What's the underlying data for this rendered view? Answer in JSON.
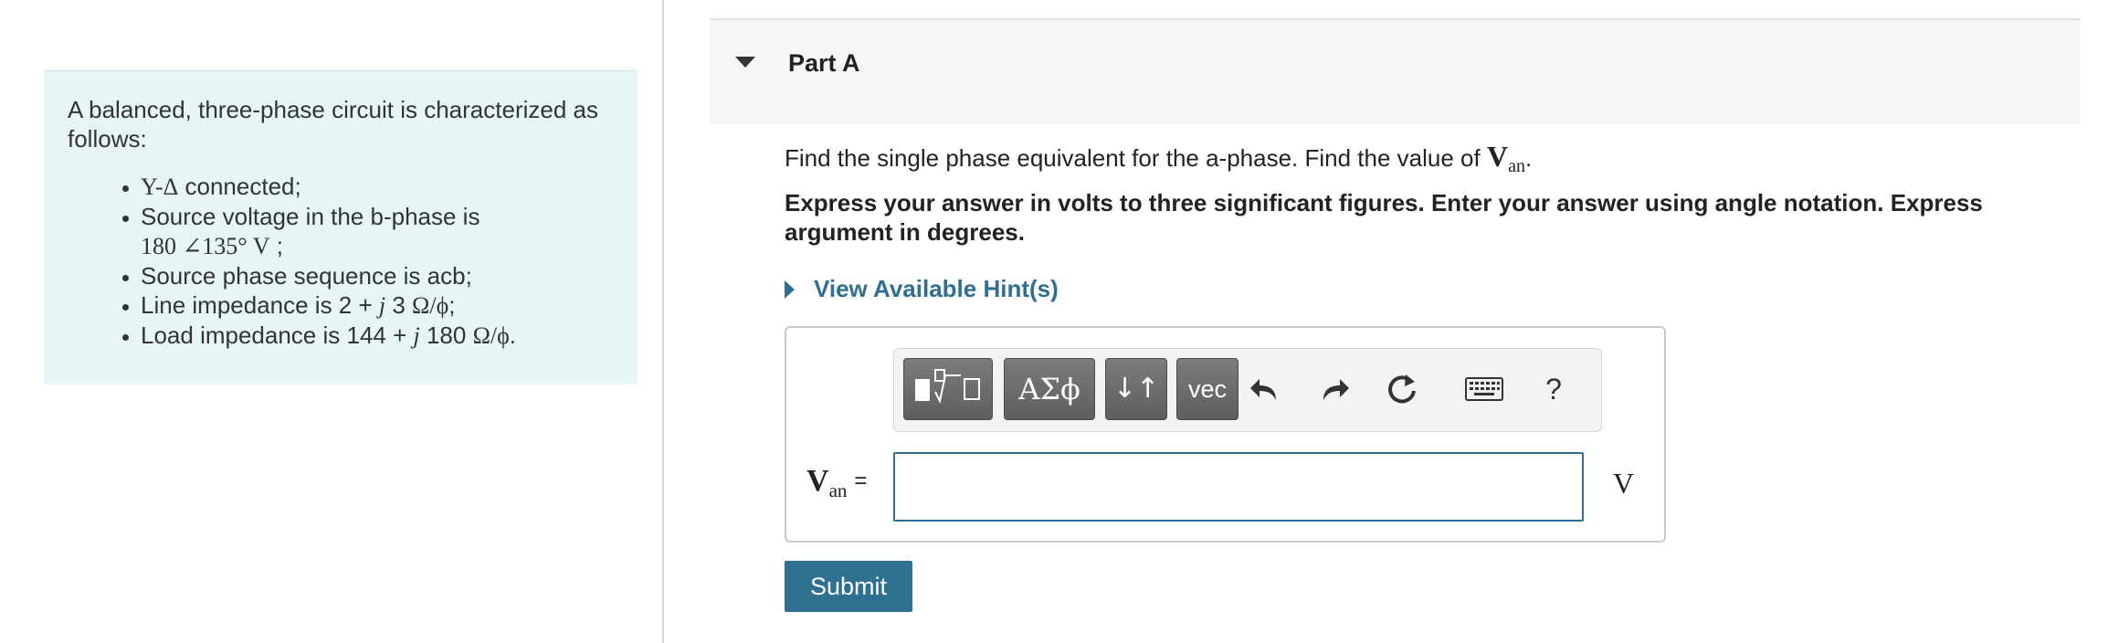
{
  "problem": {
    "intro": "A balanced, three-phase circuit is characterized as follows:",
    "conditions": [
      {
        "math": "Y-Δ",
        "text": " connected;"
      },
      {
        "text": "Source voltage in the b-phase is",
        "math": "180 ∠135°  V",
        "suffix": " ;"
      },
      {
        "text": "Source phase sequence is acb;"
      },
      {
        "text": "Line impedance is 2 + ",
        "j": "j",
        "num": " 3 ",
        "unit": "Ω/ϕ",
        "suffix": ";"
      },
      {
        "text": "Load impedance is 144 + ",
        "j": "j",
        "num": " 180 ",
        "unit": "Ω/ϕ",
        "suffix": "."
      }
    ]
  },
  "part": {
    "title": "Part A",
    "question_text": "Find the single phase equivalent for the a-phase. Find the value of ",
    "question_var": "V",
    "question_sub": "an",
    "question_end": ".",
    "instructions": "Express your answer in volts to three significant figures. Enter your answer using angle notation. Express argument in degrees."
  },
  "hint": {
    "label": "View Available Hint(s)"
  },
  "toolbar": {
    "templates_icon": "templates-icon",
    "greek_label": "ΑΣϕ",
    "arrows_label": "↓↑",
    "vec_label": "vec",
    "undo_icon": "undo-icon",
    "redo_icon": "redo-icon",
    "reset_icon": "reset-icon",
    "keyboard_icon": "keyboard-icon",
    "help_label": "?"
  },
  "answer": {
    "label_var": "V",
    "label_sub": "an",
    "equals": "=",
    "value": "",
    "unit": "V"
  },
  "submit": {
    "label": "Submit"
  },
  "colors": {
    "accent": "#2f7090",
    "panel_bg": "#e8f5f6",
    "header_bg": "#f6f6f6",
    "toolbar_button": "#6a6a6a"
  }
}
